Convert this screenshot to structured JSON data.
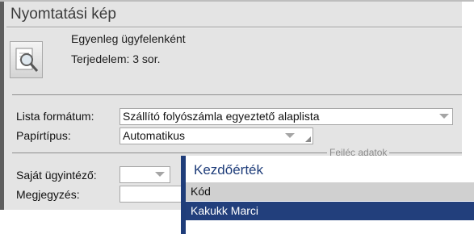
{
  "dialog": {
    "title": "Nyomtatási kép",
    "info_lines": [
      "Egyenleg ügyfelenként",
      "Terjedelem: 3 sor."
    ],
    "icon": "print-preview-icon"
  },
  "form": {
    "list_format_label": "Lista formátum:",
    "list_format_value": "Szállító folyószámla egyeztető alaplista",
    "paper_type_label": "Papírtípus:",
    "paper_type_value": "Automatikus",
    "header_section_label": "Fejléc adatok",
    "own_agent_label": "Saját ügyintéző:",
    "own_agent_value": "",
    "note_label": "Megjegyzés:",
    "note_value": ""
  },
  "lookup": {
    "title": "Kezdőérték",
    "column_header": "Kód",
    "selected_item": "Kakukk Marci"
  },
  "colors": {
    "accent": "#223f7c",
    "dialog_bg": "#e4e4e4",
    "frame": "#5e5e5e"
  }
}
